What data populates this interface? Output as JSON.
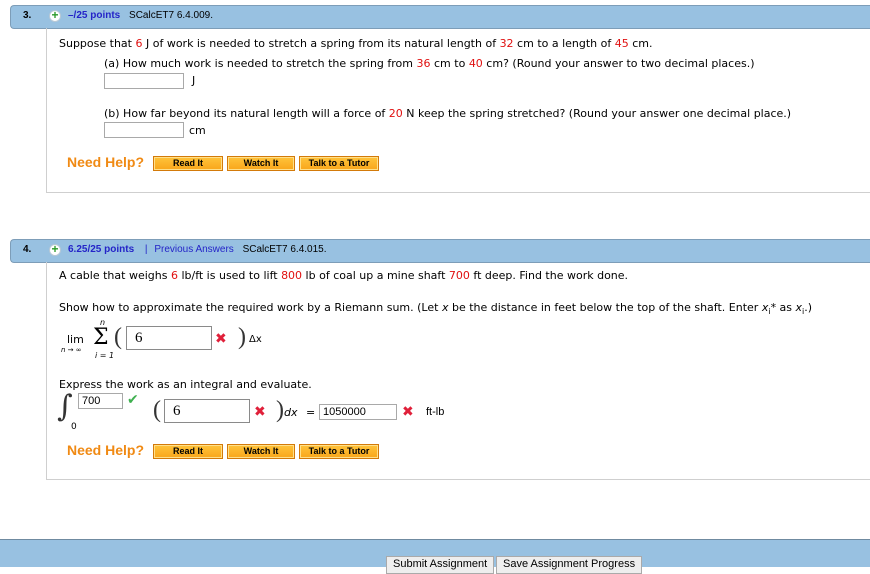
{
  "q3": {
    "number": "3.",
    "score": "–/25 points",
    "code": "SCalcET7 6.4.009.",
    "intro": {
      "t1": "Suppose that ",
      "v1": "6",
      "t2": " J of work is needed to stretch a spring from its natural length of ",
      "v2": "32",
      "t3": " cm to a length of ",
      "v3": "45",
      "t4": " cm."
    },
    "part_a": {
      "t1": "(a) How much work is needed to stretch the spring from ",
      "v1": "36",
      "t2": " cm to ",
      "v2": "40",
      "t3": " cm? (Round your answer to two decimal places.)",
      "value": "",
      "unit": "J"
    },
    "part_b": {
      "t1": "(b) How far beyond its natural length will a force of ",
      "v1": "20",
      "t2": " N keep the spring stretched? (Round your answer one decimal place.)",
      "value": "",
      "unit": "cm"
    },
    "help": {
      "label": "Need Help?",
      "read": "Read It",
      "watch": "Watch It",
      "tutor": "Talk to a Tutor"
    }
  },
  "q4": {
    "number": "4.",
    "score": "6.25/25 points",
    "separator": "|",
    "previous_answers": "Previous Answers",
    "code": "SCalcET7 6.4.015.",
    "intro": {
      "t1": "A cable that weighs ",
      "v1": "6",
      "t2": " lb/ft is used to lift ",
      "v2": "800",
      "t3": " lb of coal up a mine shaft ",
      "v3": "700",
      "t4": " ft deep. Find the work done."
    },
    "riemann_prompt": {
      "t1": "Show how to approximate the required work by a Riemann sum. (Let ",
      "x": "x",
      "t2": " be the distance in feet below the top of the shaft. Enter ",
      "xs": "x",
      "sub1": "i",
      "t3": "* as ",
      "xs2": "x",
      "sub2": "i",
      "t4": ".)"
    },
    "riemann": {
      "lim": "lim",
      "lim_sub": "n → ∞",
      "sigma": "Σ",
      "sigma_top": "n",
      "sigma_bottom": "i = 1",
      "value": "6",
      "status": "incorrect",
      "dx": "Δx"
    },
    "integral_prompt": "Express the work as an integral and evaluate.",
    "integral": {
      "upper": "700",
      "upper_status": "correct",
      "lower": "0",
      "integrand": "6",
      "integrand_status": "incorrect",
      "dx": "dx",
      "equals": "=",
      "result": "1050000",
      "result_status": "incorrect",
      "unit": "ft-lb"
    },
    "help": {
      "label": "Need Help?",
      "read": "Read It",
      "watch": "Watch It",
      "tutor": "Talk to a Tutor"
    }
  },
  "footer": {
    "submit": "Submit Assignment",
    "save": "Save Assignment Progress"
  },
  "icons": {
    "correct": "✔",
    "incorrect": "✖"
  }
}
